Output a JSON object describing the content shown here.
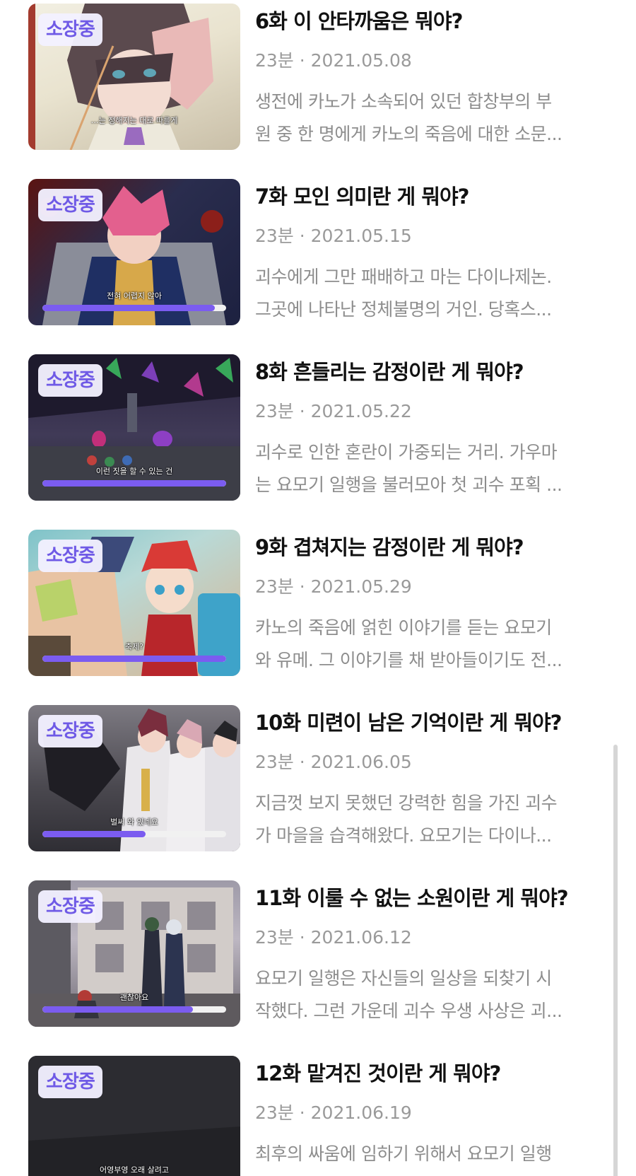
{
  "badge_label": "소장중",
  "episodes": [
    {
      "title": "6화 이 안타까움은 뭐야?",
      "meta": "23분 · 2021.05.08",
      "desc_line1": "생전에 카노가 소속되어 있던 합창부의 부",
      "desc_line2": "원 중 한 명에게 카노의 죽음에 대한 소문...",
      "caption": "…는 정해지는 대로 따를게",
      "progress": null
    },
    {
      "title": "7화 모인 의미란 게 뭐야?",
      "meta": "23분 · 2021.05.15",
      "desc_line1": "괴수에게 그만 패배하고 마는 다이나제논.",
      "desc_line2": "그곳에 나타난 정체불명의 거인. 당혹스...",
      "caption": "전혀 어렵지 않아",
      "progress": 0.94
    },
    {
      "title": "8화 흔들리는 감정이란 게 뭐야?",
      "meta": "23분 · 2021.05.22",
      "desc_line1": "괴수로 인한 혼란이 가중되는 거리. 가우마",
      "desc_line2": "는 요모기 일행을 불러모아 첫 괴수 포획 ...",
      "caption": "이런 짓을 할 수 있는 건",
      "progress": 1.0
    },
    {
      "title": "9화 겹쳐지는 감정이란 게 뭐야?",
      "meta": "23분 · 2021.05.29",
      "desc_line1": "카노의 죽음에 얽힌 이야기를 듣는 요모기",
      "desc_line2": "와 유메. 그 이야기를 채 받아들이기도 전...",
      "caption": "축제?",
      "progress": 1.0
    },
    {
      "title": "10화 미련이 남은 기억이란 게 뭐야?",
      "meta": "23분 · 2021.06.05",
      "desc_line1": "지금껏 보지 못했던 강력한 힘을 가진 괴수",
      "desc_line2": "가 마을을 습격해왔다. 요모기는 다이나...",
      "caption": "벌써 와 있네요",
      "progress": 0.56
    },
    {
      "title": "11화 이룰 수 없는 소원이란 게 뭐야?",
      "meta": "23분 · 2021.06.12",
      "desc_line1": "요모기 일행은 자신들의 일상을 되찾기 시",
      "desc_line2": "작했다. 그런 가운데 괴수 우생 사상은 괴...",
      "caption": "괜찮아요",
      "progress": 0.82
    },
    {
      "title": "12화 맡겨진 것이란 게 뭐야?",
      "meta": "23분 · 2021.06.19",
      "desc_line1": "최후의 싸움에 임하기 위해서 요모기 일행",
      "desc_line2": "",
      "caption": "어영부영 오래 살려고",
      "progress": null
    }
  ]
}
